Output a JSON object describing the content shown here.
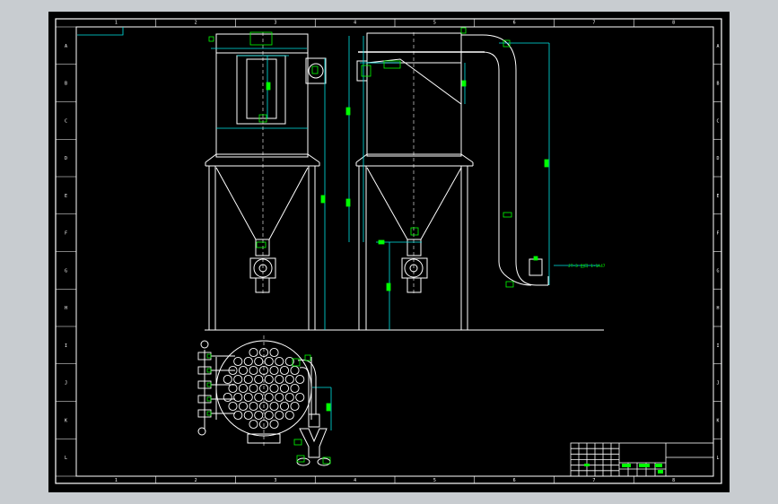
{
  "colors": {
    "background": "#c8ccd0",
    "paper": "#000000",
    "outline": "#ffffff",
    "dimension": "#00ff00",
    "leader": "#00e5e5"
  },
  "border": {
    "column_labels": [
      "1",
      "2",
      "3",
      "4",
      "5",
      "6",
      "7",
      "8"
    ],
    "row_labels": [
      "A",
      "B",
      "C",
      "D",
      "E",
      "F",
      "G",
      "H",
      "I",
      "J",
      "K",
      "L"
    ]
  },
  "annotations": {
    "outlet_note": "JT-3 出口 1-1A47"
  }
}
